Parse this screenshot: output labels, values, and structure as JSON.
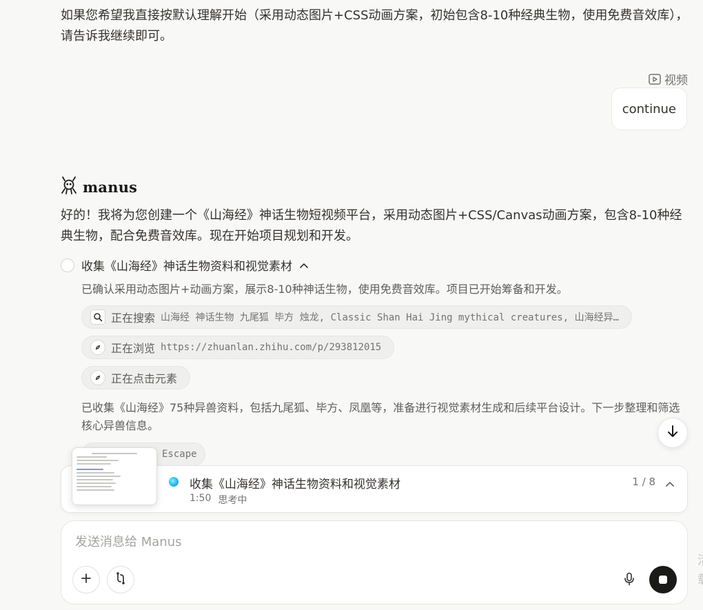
{
  "intro_text": "如果您希望我直接按默认理解开始（采用动态图片+CSS动画方案，初始包含8-10种经典生物，使用免费音效库），请告诉我继续即可。",
  "video_label": "视频",
  "user_message": "continue",
  "agent": {
    "name": "manus",
    "icon": "manus-logo-icon"
  },
  "reply_text": "好的！我将为您创建一个《山海经》神话生物短视频平台，采用动态图片+CSS/Canvas动画方案，包含8-10种经典生物，配合免费音效库。现在开始项目规划和开发。",
  "step": {
    "title": "收集《山海经》神话生物资料和视觉素材",
    "note": "已确认采用动态图片+动画方案，展示8-10种神话生物，使用免费音效库。项目已开始筹备和开发。",
    "actions": [
      {
        "label": "正在搜索",
        "detail": "山海经 神话生物 九尾狐 毕方 烛龙, Classic Shan Hai Jing mythical creatures, 山海经异…",
        "icon": "search-icon"
      },
      {
        "label": "正在浏览",
        "detail": "https://zhuanlan.zhihu.com/p/293812015",
        "icon": "compass-icon"
      },
      {
        "label": "正在点击元素",
        "detail": "",
        "icon": "compass-icon"
      }
    ],
    "summary": "已收集《山海经》75种异兽资料，包括九尾狐、毕方、凤凰等，准备进行视觉素材生成和后续平台设计。下一步整理和筛选核心异兽信息。",
    "pending_action": "Escape"
  },
  "task_card": {
    "title": "收集《山海经》神话生物资料和视觉素材",
    "elapsed": "1:50",
    "status": "思考中",
    "progress": "1 / 8"
  },
  "composer": {
    "placeholder": "发送消息给 Manus",
    "accent": "#1a1a19"
  },
  "edge_text": "活\n载"
}
